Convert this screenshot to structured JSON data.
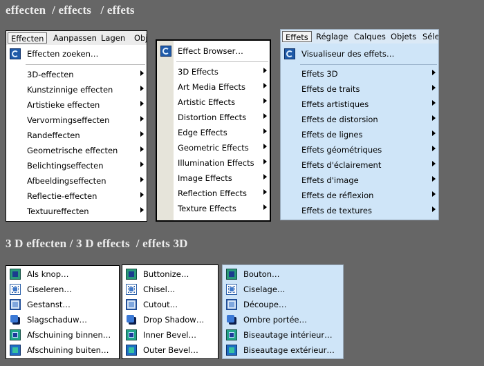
{
  "headings": {
    "top": "effecten  / effects   / effets",
    "bottom": "3 D effecten / 3 D effects  / effets 3D"
  },
  "nl_menu": {
    "menubar": [
      "Effecten",
      "Aanpassen",
      "Lagen",
      "Obj"
    ],
    "browser": "Effecten zoeken…",
    "items": [
      "3D-effecten",
      "Kunstzinnige effecten",
      "Artistieke effecten",
      "Vervormingseffecten",
      "Randeffecten",
      "Geometrische effecten",
      "Belichtingseffecten",
      "Afbeeldingseffecten",
      "Reflectie-effecten",
      "Textuureffecten"
    ]
  },
  "en_menu": {
    "browser": "Effect Browser…",
    "items": [
      "3D Effects",
      "Art Media Effects",
      "Artistic Effects",
      "Distortion Effects",
      "Edge Effects",
      "Geometric Effects",
      "Illumination Effects",
      "Image Effects",
      "Reflection Effects",
      "Texture Effects"
    ]
  },
  "fr_menu": {
    "menubar": [
      "Effets",
      "Réglage",
      "Calques",
      "Objets",
      "Sélec"
    ],
    "browser": "Visualiseur des effets…",
    "items": [
      "Effets 3D",
      "Effets de traits",
      "Effets artistiques",
      "Effets de distorsion",
      "Effets de lignes",
      "Effets géométriques",
      "Effets d'éclairement",
      "Effets d'image",
      "Effets de réflexion",
      "Effets de textures"
    ]
  },
  "nl_3d": [
    "Als knop…",
    "Ciseleren…",
    "Gestanst…",
    "Slagschaduw…",
    "Afschuining binnen…",
    "Afschuining buiten…"
  ],
  "en_3d": [
    "Buttonize…",
    "Chisel…",
    "Cutout…",
    "Drop Shadow…",
    "Inner Bevel…",
    "Outer Bevel…"
  ],
  "fr_3d": [
    "Bouton…",
    "Ciselage…",
    "Découpe…",
    "Ombre portée…",
    "Biseautage intérieur…",
    "Biseautage extérieur…"
  ],
  "icons": [
    "buttonize-icon",
    "chisel-icon",
    "cutout-icon",
    "drop-shadow-icon",
    "inner-bevel-icon",
    "outer-bevel-icon"
  ],
  "colors": {
    "background": "#666666",
    "french_panel": "#cfe5f8",
    "english_sidebar": "#e6e4da"
  }
}
